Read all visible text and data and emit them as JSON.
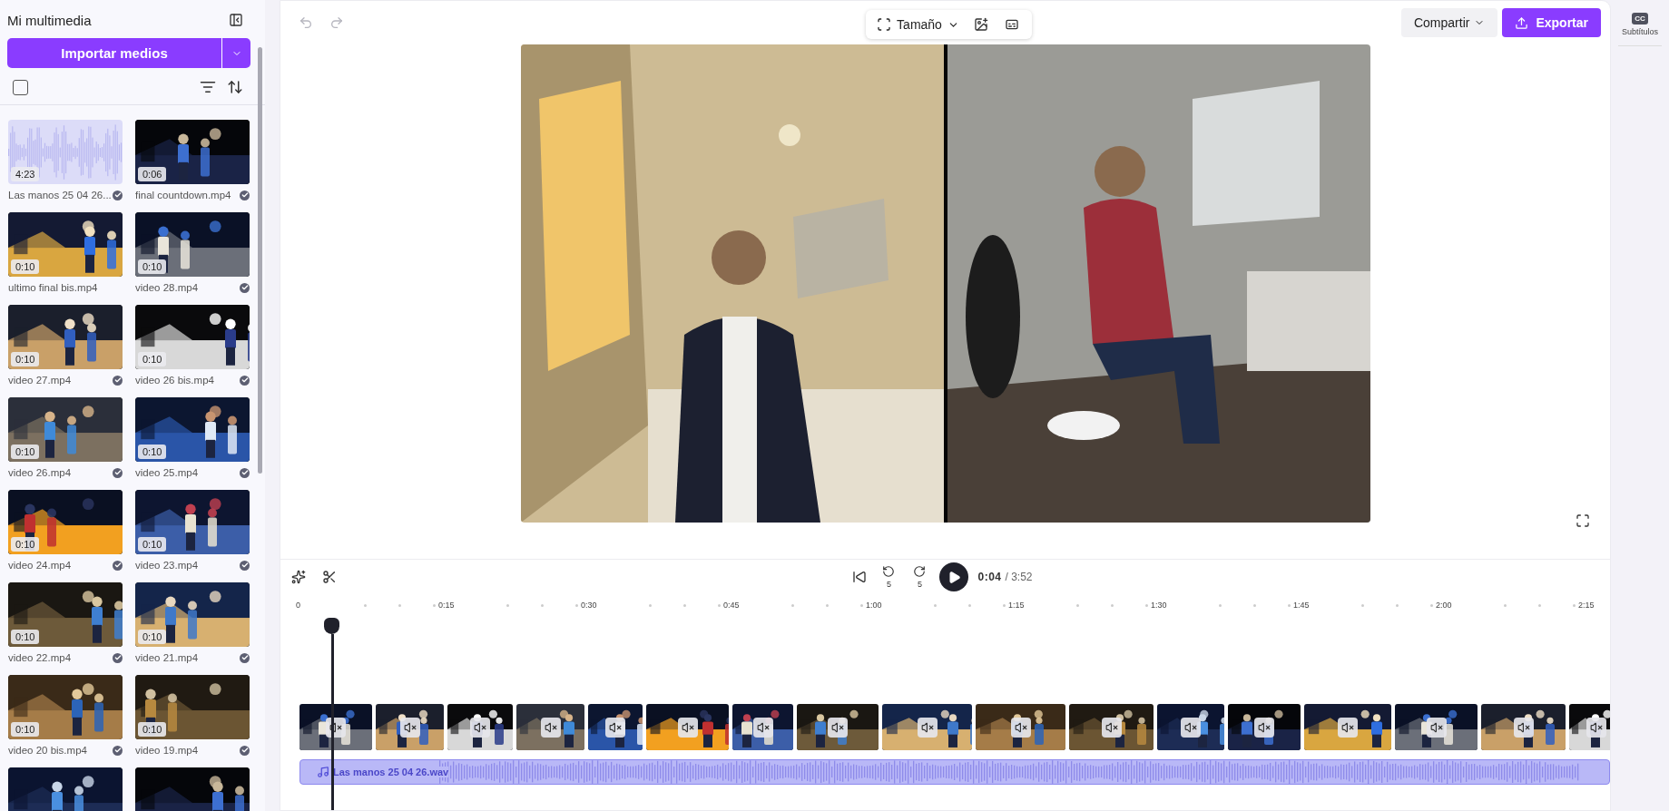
{
  "media_panel": {
    "title": "Mi multimedia",
    "import_button": "Importar medios",
    "select_all": {
      "checked": false
    },
    "items": [
      {
        "kind": "audio",
        "duration": "4:23",
        "name": "Las manos 25 04 26...",
        "checked": true
      },
      {
        "kind": "video",
        "duration": "0:06",
        "name": "final countdown.mp4",
        "checked": true
      },
      {
        "kind": "video",
        "duration": "0:10",
        "name": "ultimo final bis.mp4",
        "checked": false
      },
      {
        "kind": "video",
        "duration": "0:10",
        "name": "video 28.mp4",
        "checked": true
      },
      {
        "kind": "video",
        "duration": "0:10",
        "name": "video 27.mp4",
        "checked": true
      },
      {
        "kind": "video",
        "duration": "0:10",
        "name": "video 26 bis.mp4",
        "checked": true
      },
      {
        "kind": "video",
        "duration": "0:10",
        "name": "video 26.mp4",
        "checked": true
      },
      {
        "kind": "video",
        "duration": "0:10",
        "name": "video 25.mp4",
        "checked": true
      },
      {
        "kind": "video",
        "duration": "0:10",
        "name": "video 24.mp4",
        "checked": true
      },
      {
        "kind": "video",
        "duration": "0:10",
        "name": "video 23.mp4",
        "checked": true
      },
      {
        "kind": "video",
        "duration": "0:10",
        "name": "video 22.mp4",
        "checked": true
      },
      {
        "kind": "video",
        "duration": "0:10",
        "name": "video 21.mp4",
        "checked": true
      },
      {
        "kind": "video",
        "duration": "0:10",
        "name": "video 20 bis.mp4",
        "checked": true
      },
      {
        "kind": "video",
        "duration": "0:10",
        "name": "video 19.mp4",
        "checked": true
      },
      {
        "kind": "picture"
      },
      {
        "kind": "picture"
      }
    ]
  },
  "toolbar": {
    "undo": {
      "disabled": true
    },
    "redo": {
      "disabled": true
    },
    "size_button": "Tamaño",
    "share_button": "Compartir",
    "export_button": "Exportar"
  },
  "right_rail": {
    "captions": {
      "badge": "CC",
      "label": "Subtítulos"
    }
  },
  "playback": {
    "rewind_seconds": "5",
    "forward_seconds": "5",
    "current_time": "0:04",
    "total_time": "/ 3:52"
  },
  "ruler": {
    "labels": [
      "0",
      "0:15",
      "0:30",
      "0:45",
      "1:00",
      "1:15",
      "1:30",
      "1:45",
      "2:00",
      "2:15"
    ]
  },
  "timeline": {
    "video_clips": [
      {
        "muted": true
      },
      {
        "muted": true
      },
      {
        "muted": true
      },
      {
        "muted": true
      },
      {
        "muted": true
      },
      {
        "muted": true
      },
      {
        "muted": true
      },
      {
        "muted": true
      },
      {
        "muted": true
      },
      {
        "muted": true
      },
      {
        "muted": true
      },
      {
        "muted": true
      },
      {
        "muted": true
      },
      {
        "muted": true
      },
      {
        "muted": true
      },
      {
        "muted": true
      },
      {
        "muted": true
      }
    ],
    "audio_clip": {
      "name": "Las manos 25 04 26.wav"
    }
  }
}
